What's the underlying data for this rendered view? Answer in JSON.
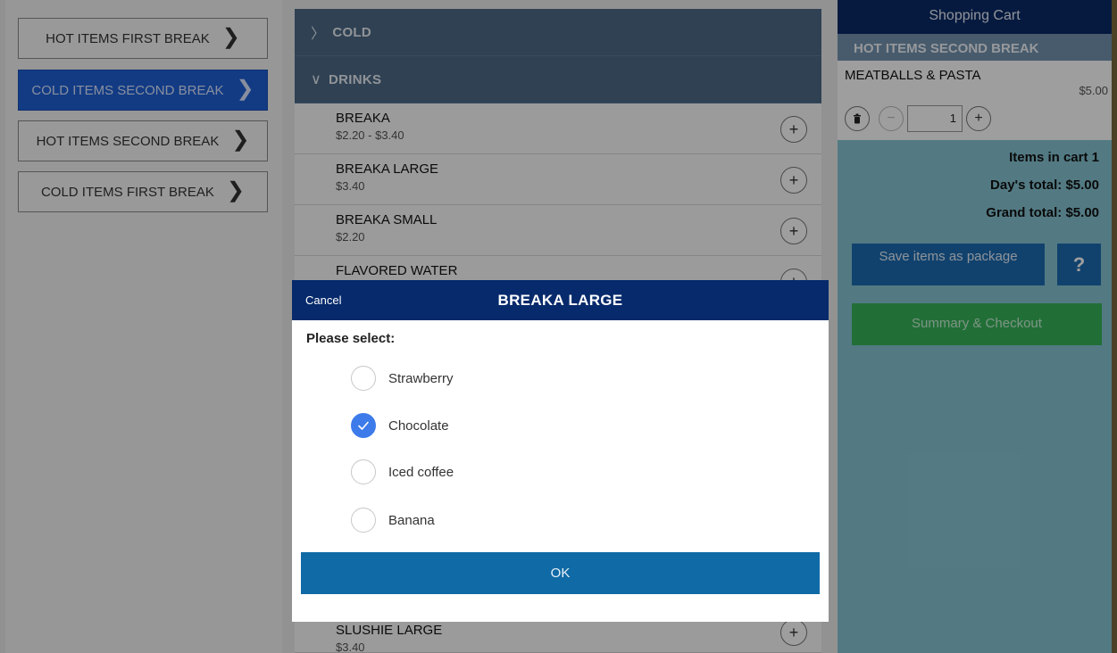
{
  "categories": [
    {
      "label": "HOT ITEMS FIRST BREAK",
      "active": false
    },
    {
      "label": "COLD ITEMS SECOND BREAK",
      "active": true
    },
    {
      "label": "HOT ITEMS SECOND BREAK",
      "active": false
    },
    {
      "label": "COLD ITEMS FIRST BREAK",
      "active": false
    }
  ],
  "menu": {
    "sections": [
      {
        "label": "COLD",
        "chevron": ">"
      },
      {
        "label": "DRINKS",
        "chevron": "v"
      }
    ],
    "items": [
      {
        "name": "BREAKA",
        "price": "$2.20 - $3.40"
      },
      {
        "name": "BREAKA LARGE",
        "price": "$3.40"
      },
      {
        "name": "BREAKA SMALL",
        "price": "$2.20"
      },
      {
        "name": "FLAVORED WATER",
        "price": ""
      }
    ],
    "bottom_item": {
      "name": "SLUSHIE LARGE",
      "price": "$3.40"
    }
  },
  "cart": {
    "title": "Shopping Cart",
    "group": "HOT ITEMS SECOND BREAK",
    "item": {
      "name": "MEATBALLS & PASTA",
      "price": "$5.00",
      "quantity": "1"
    },
    "items_in_cart": "Items in cart 1",
    "days_total": "Day's total: $5.00",
    "grand_total": "Grand total: $5.00",
    "save_label": "Save items as package",
    "help_label": "?",
    "checkout_label": "Summary & Checkout"
  },
  "modal": {
    "cancel": "Cancel",
    "title": "BREAKA LARGE",
    "prompt": "Please select:",
    "options": [
      {
        "label": "Strawberry",
        "checked": false
      },
      {
        "label": "Chocolate",
        "checked": true
      },
      {
        "label": "Iced coffee",
        "checked": false
      },
      {
        "label": "Banana",
        "checked": false
      }
    ],
    "ok": "OK"
  },
  "colors": {
    "accent_active_category": "#1e5fd6",
    "section_header": "#4c6a86",
    "cart_background": "#87c6d4",
    "cart_title_bar": "#0a2a66",
    "modal_header": "#062a6b",
    "ok_button": "#0f6aa6",
    "checkout_button": "#36b45a",
    "radio_checked": "#3d7bea"
  },
  "icons": {
    "category_chevron": "chevron-right-icon",
    "add_item": "plus-icon",
    "delete": "trash-icon",
    "decrement": "minus-icon",
    "increment": "plus-icon",
    "checkmark": "check-icon"
  }
}
